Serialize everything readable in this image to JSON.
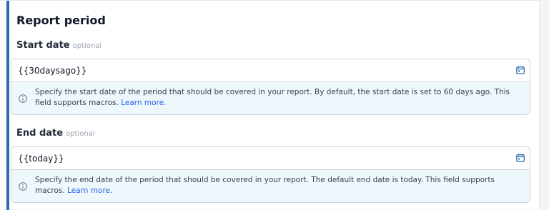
{
  "section": {
    "title": "Report period"
  },
  "start_date": {
    "label": "Start date",
    "optional_tag": "optional",
    "value": "{{30daysago}}",
    "help_text": "Specify the start date of the period that should be covered in your report. By default, the start date is set to 60 days ago. This field supports macros.",
    "learn_more": "Learn more."
  },
  "end_date": {
    "label": "End date",
    "optional_tag": "optional",
    "value": "{{today}}",
    "help_text": "Specify the end date of the period that should be covered in your report. The default end date is today. This field supports macros.",
    "learn_more": "Learn more."
  },
  "icons": {
    "calendar": "calendar-icon",
    "info": "info-icon"
  },
  "colors": {
    "accent": "#2b6cb0",
    "link": "#2563eb",
    "help_background": "#eef7fb"
  }
}
